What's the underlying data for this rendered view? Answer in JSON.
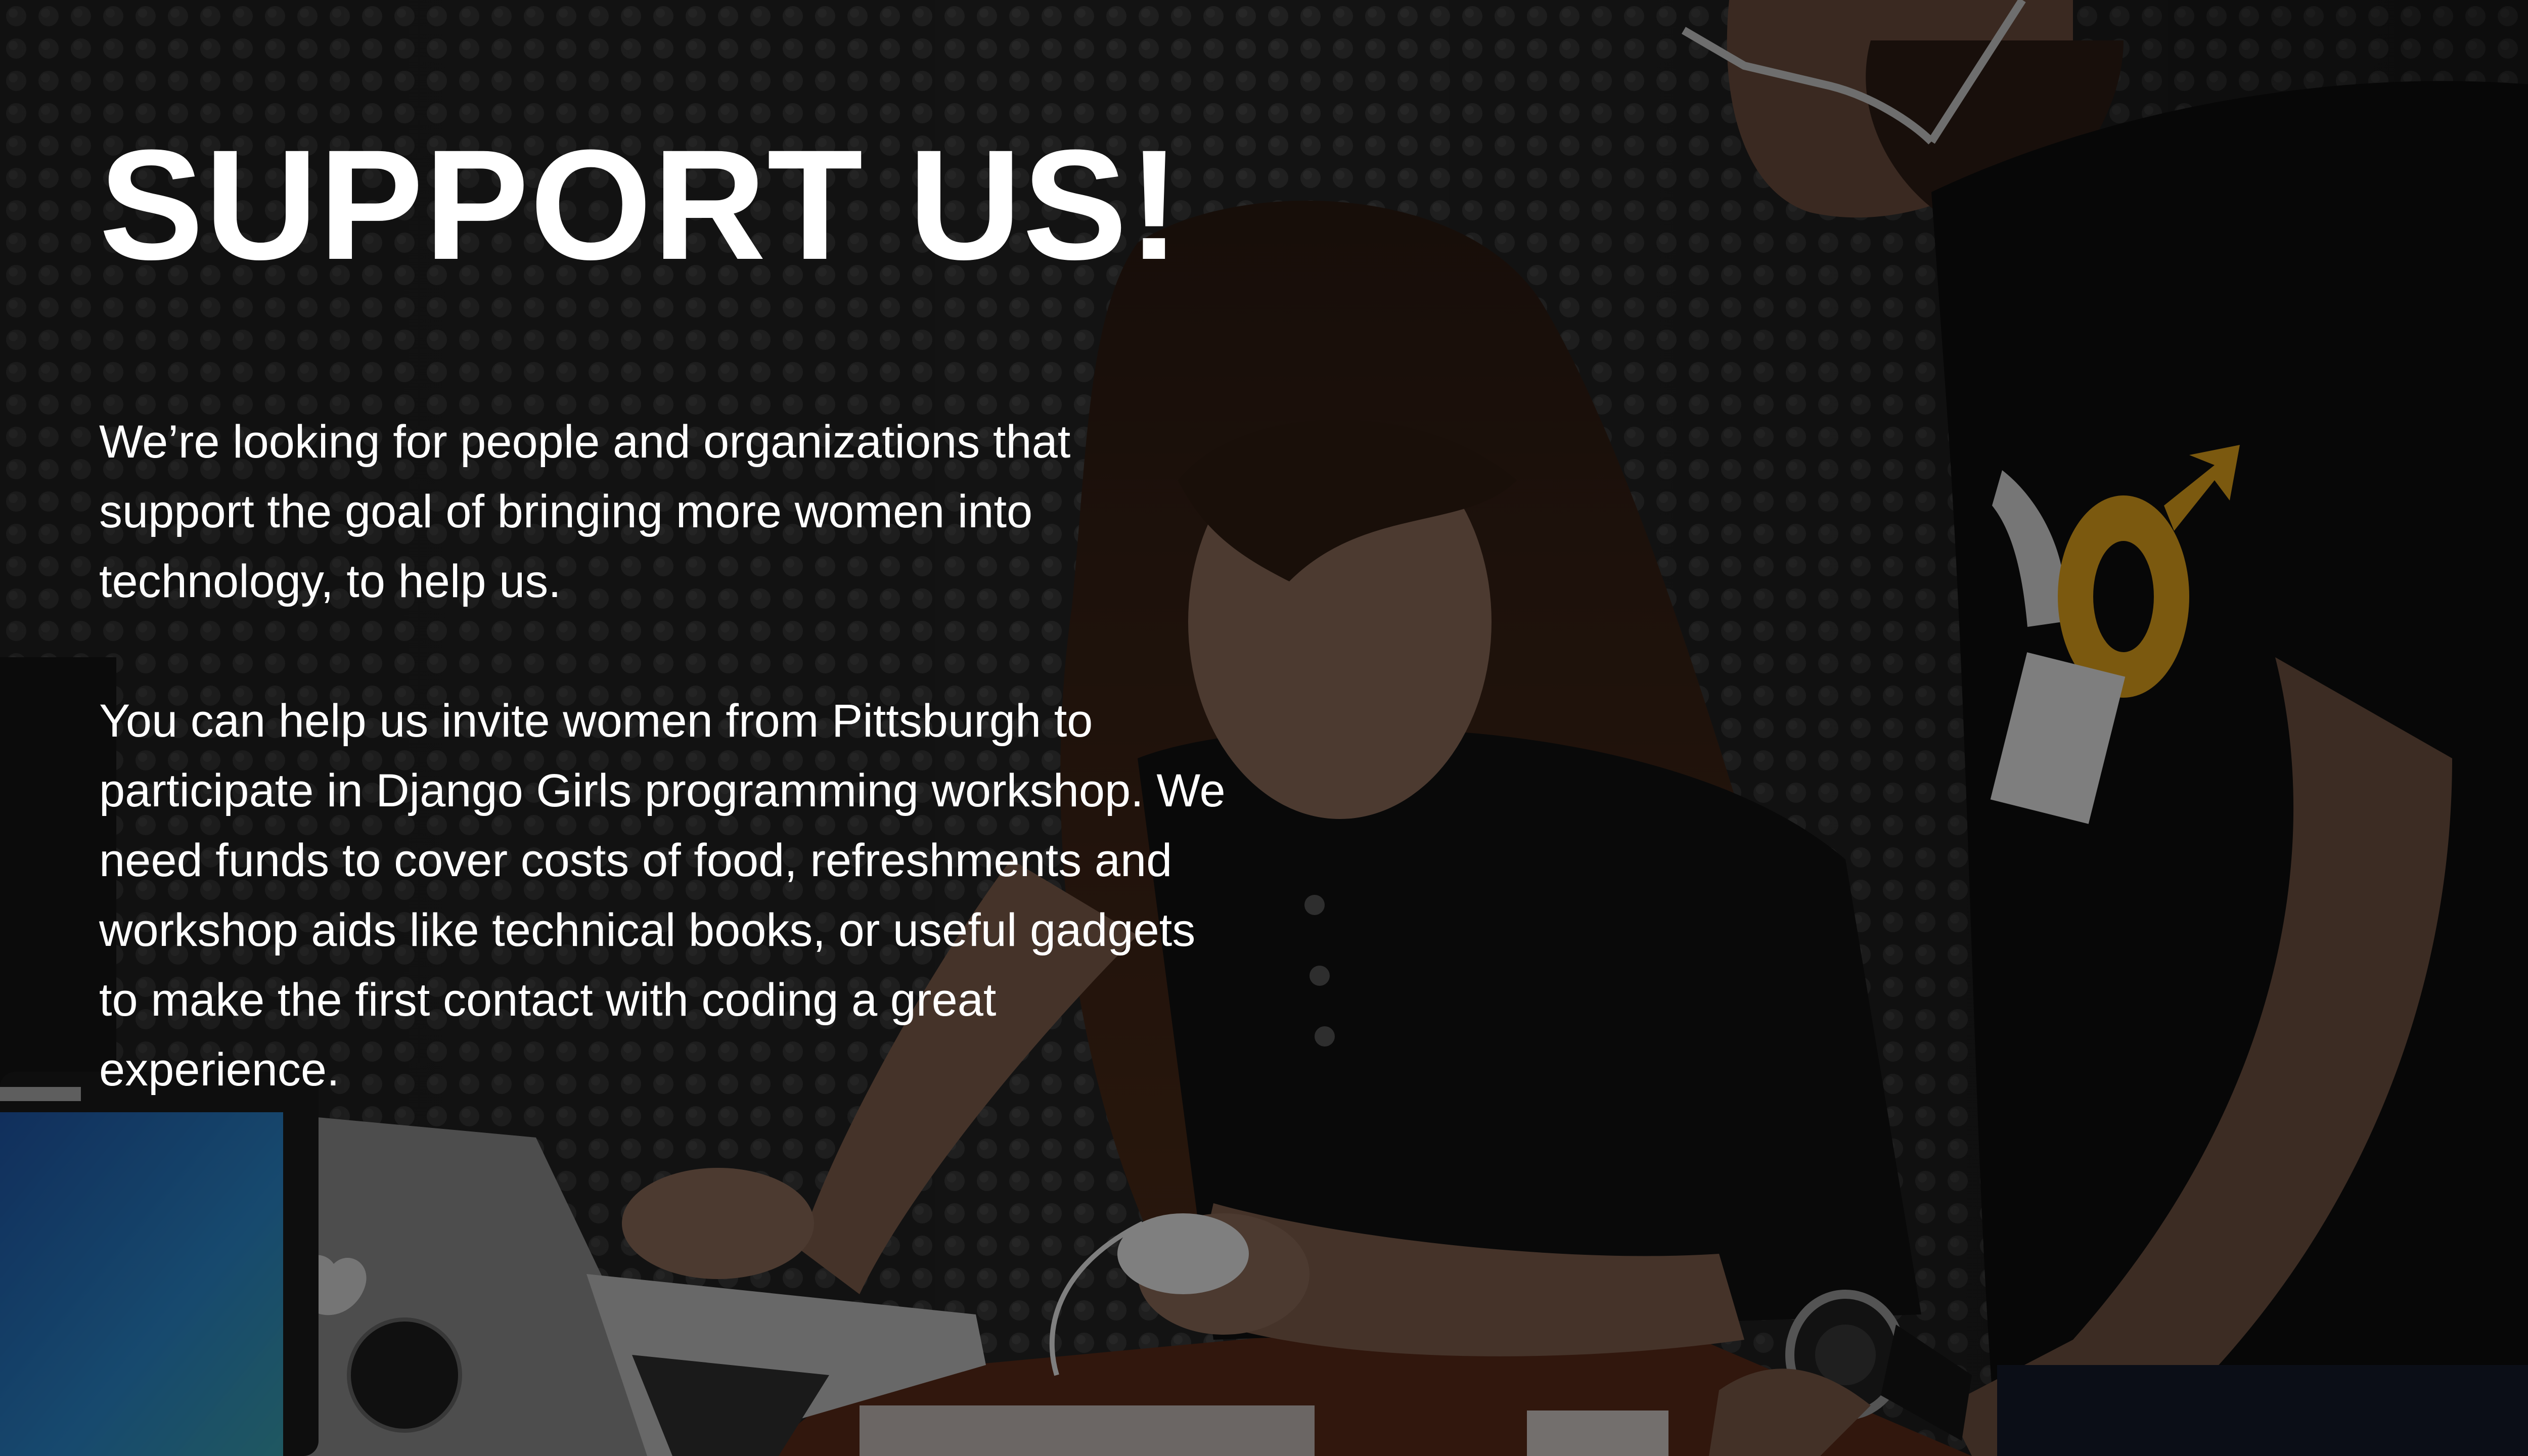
{
  "slide": {
    "title": "SUPPORT US!",
    "paragraphs": [
      "We’re looking for people and organizations that support the goal of bringing more women into technology, to help us.",
      "You can help us invite women from Pittsburgh to participate in Django Girls programming workshop. We need funds to cover costs of food, refreshments and workshop aids like technical books, or useful gadgets to make the first contact with coding a great experience."
    ]
  },
  "colors": {
    "text": "#ffffff",
    "background": "#222222",
    "shirt_accent": "#e0a21c"
  }
}
